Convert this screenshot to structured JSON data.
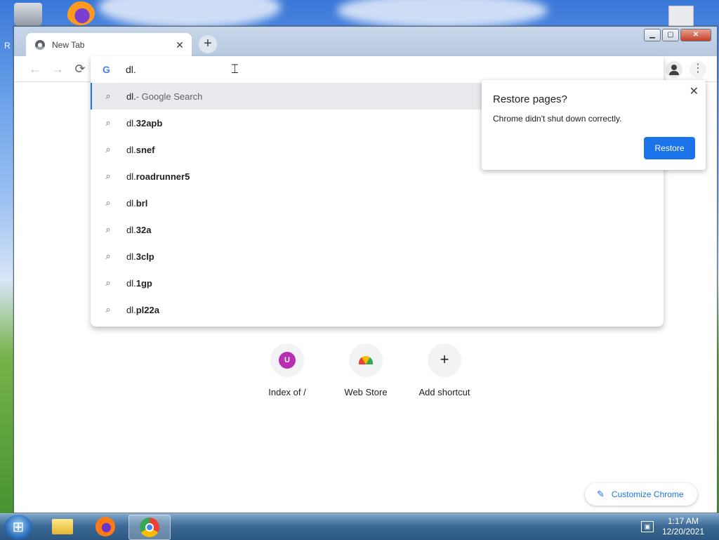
{
  "desktop": {
    "side_letter": "R"
  },
  "browser": {
    "tab": {
      "title": "New Tab",
      "close_glyph": "✕"
    },
    "new_tab_glyph": "+",
    "window_controls": {
      "minimize": "▁",
      "maximize": "▢",
      "close": "✕"
    },
    "toolbar": {
      "back_glyph": "←",
      "forward_glyph": "→",
      "reload_glyph": "⟳",
      "menu_glyph": "⋮"
    },
    "omnibox": {
      "logo": "G",
      "value": "dl.",
      "suggestions": [
        {
          "prefix": "dl.",
          "bold": "",
          "desc": " - Google Search",
          "icon": "search-icon"
        },
        {
          "prefix": "dl.",
          "bold": "32apb",
          "desc": "",
          "icon": "search-icon"
        },
        {
          "prefix": "dl.",
          "bold": "snef",
          "desc": "",
          "icon": "search-icon"
        },
        {
          "prefix": "dl.",
          "bold": "roadrunner5",
          "desc": "",
          "icon": "search-icon"
        },
        {
          "prefix": "dl.",
          "bold": "brl",
          "desc": "",
          "icon": "search-icon"
        },
        {
          "prefix": "dl.",
          "bold": "32a",
          "desc": "",
          "icon": "search-icon"
        },
        {
          "prefix": "dl.",
          "bold": "3clp",
          "desc": "",
          "icon": "search-icon"
        },
        {
          "prefix": "dl.",
          "bold": "1gp",
          "desc": "",
          "icon": "search-icon"
        },
        {
          "prefix": "dl.",
          "bold": "pl22a",
          "desc": "",
          "icon": "search-icon"
        }
      ]
    },
    "restore_bubble": {
      "title": "Restore pages?",
      "text": "Chrome didn't shut down correctly.",
      "button": "Restore",
      "close_glyph": "✕"
    },
    "shortcuts": [
      {
        "label": "Index of /",
        "avatar_letter": "U",
        "avatar_color": "#b92fb1"
      },
      {
        "label": "Web Store",
        "icon": "web-store-icon"
      },
      {
        "label": "Add shortcut",
        "icon": "plus-icon",
        "glyph": "+"
      }
    ],
    "customize": {
      "label": "Customize Chrome",
      "icon": "pencil-icon",
      "glyph": "✎"
    }
  },
  "taskbar": {
    "items": [
      "explorer-icon",
      "firefox-icon",
      "chrome-icon"
    ],
    "active": "chrome-icon",
    "clock": {
      "time": "1:17 AM",
      "date": "12/20/2021"
    }
  },
  "colors": {
    "accent": "#1a73e8",
    "taskbar": "#2b5782"
  }
}
